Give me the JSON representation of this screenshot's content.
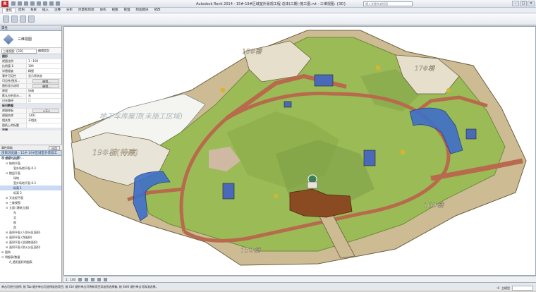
{
  "app": {
    "title": "Autodesk Revit 2014 -    15#-19#区域室外景观工程-总体(三期)-施工图.rvt - 三维视图: {3D}",
    "search_placeholder": "键入关键字或短语",
    "logo": "R"
  },
  "ribbon": {
    "tabs": [
      "建筑",
      "结构",
      "系统",
      "插入",
      "注释",
      "分析",
      "体量和场地",
      "协作",
      "视图",
      "管理",
      "附加模块",
      "修改"
    ]
  },
  "properties": {
    "title": "属性",
    "type_name": "三维视图",
    "type_select": "三维视图: {3D}",
    "edit_type": "编辑类型",
    "rows": [
      {
        "k": "图形",
        "v": "",
        "group": true
      },
      {
        "k": "视图比例",
        "v": "1 : 100"
      },
      {
        "k": "比例值 1:",
        "v": "100"
      },
      {
        "k": "详细程度",
        "v": "精细"
      },
      {
        "k": "零件可见性",
        "v": "显示原状态"
      },
      {
        "k": "可见性/图形...",
        "v": "编辑...",
        "btn": true
      },
      {
        "k": "图形显示选项",
        "v": "编辑...",
        "btn": true
      },
      {
        "k": "规程",
        "v": "协调"
      },
      {
        "k": "默认分析显示...",
        "v": "无"
      },
      {
        "k": "日光路径",
        "v": "☐"
      },
      {
        "k": "标识数据",
        "v": "",
        "group": true
      },
      {
        "k": "视图样板",
        "v": "<无>",
        "btn": true
      },
      {
        "k": "视图名称",
        "v": "{3D}"
      },
      {
        "k": "相关性",
        "v": "不相关"
      },
      {
        "k": "图纸上的标题",
        "v": ""
      },
      {
        "k": "范围",
        "v": "",
        "group": true
      }
    ],
    "help": "属性帮助",
    "apply": "应用"
  },
  "browser": {
    "title": "项目浏览器 - 15#-19#区域室外景观工程-总体(三期)...",
    "items": [
      {
        "label": "视图 (全部)",
        "level": 0,
        "tw": "⊟"
      },
      {
        "label": "结构平面",
        "level": 1,
        "tw": "⊟"
      },
      {
        "label": "室外场地平面-0.3",
        "level": 2,
        "tw": ""
      },
      {
        "label": "楼层平面",
        "level": 1,
        "tw": "⊟"
      },
      {
        "label": "场地",
        "level": 2,
        "tw": ""
      },
      {
        "label": "室外场地平面-0.3",
        "level": 2,
        "tw": ""
      },
      {
        "label": "标高 1",
        "level": 2,
        "tw": "",
        "sel": true
      },
      {
        "label": "标高 2",
        "level": 2,
        "tw": ""
      },
      {
        "label": "天花板平面",
        "level": 1,
        "tw": "⊞"
      },
      {
        "label": "三维视图",
        "level": 1,
        "tw": "⊞"
      },
      {
        "label": "立面 (建筑立面)",
        "level": 1,
        "tw": "⊟"
      },
      {
        "label": "东",
        "level": 2,
        "tw": ""
      },
      {
        "label": "北",
        "level": 2,
        "tw": ""
      },
      {
        "label": "南",
        "level": 2,
        "tw": ""
      },
      {
        "label": "西",
        "level": 2,
        "tw": ""
      },
      {
        "label": "面积平面 (人防分区面积)",
        "level": 1,
        "tw": "⊞"
      },
      {
        "label": "面积平面 (净面积)",
        "level": 1,
        "tw": "⊞"
      },
      {
        "label": "面积平面 (总建筑面积)",
        "level": 1,
        "tw": "⊞"
      },
      {
        "label": "面积平面 (防火分区面积)",
        "level": 1,
        "tw": "⊞"
      },
      {
        "label": "图例",
        "level": 0,
        "tw": "⊞"
      },
      {
        "label": "明细表/数量",
        "level": 0,
        "tw": "⊟"
      },
      {
        "label": "A_墙用面积明细表",
        "level": 1,
        "tw": ""
      }
    ]
  },
  "viewport": {
    "labels": {
      "b18": "18#楼",
      "b17": "17#楼",
      "b19": "19#楼(待建)",
      "b16": "16#楼",
      "b15": "15#楼",
      "garage": "地下车库屋顶(未施工区域)"
    }
  },
  "view_bar": {
    "scale": "1 : 100"
  },
  "status": {
    "text": "单击可进行选择; 按 Tab 键并单击可选择其他项目; 按 Ctrl 键并单击可将新项目添加到选择集; 按 Shift 键并单击可取消选择。",
    "model": "主模型",
    "zoom": ":0"
  },
  "colors": {
    "lawn": "#9bbb57",
    "lawn_dark": "#7ea046",
    "path": "#b86a4c",
    "plaza": "#8a4a22",
    "wall": "#cdbb93",
    "glass": "#3f6fc8"
  }
}
